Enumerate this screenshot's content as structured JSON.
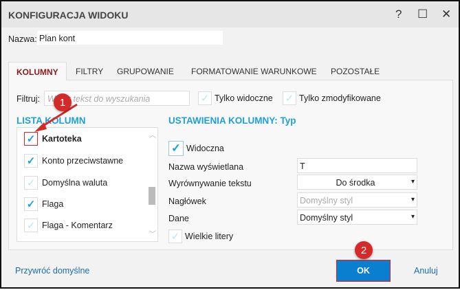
{
  "window": {
    "title": "KONFIGURACJA WIDOKU",
    "help": "?",
    "maximize": "☐",
    "close": "✕"
  },
  "name": {
    "label": "Nazwa:",
    "value": "Plan kont"
  },
  "tabs": [
    "KOLUMNY",
    "FILTRY",
    "GRUPOWANIE",
    "FORMATOWANIE WARUNKOWE",
    "POZOSTAŁE"
  ],
  "filter": {
    "label": "Filtruj:",
    "placeholder": "Wpisz tekst do wyszukania",
    "only_visible": "Tylko widoczne",
    "only_modified": "Tylko zmodyfikowane"
  },
  "column_list": {
    "heading": "LISTA KOLUMN",
    "items": [
      {
        "label": "Kartoteka",
        "checked": true
      },
      {
        "label": "Konto przeciwstawne",
        "checked": true
      },
      {
        "label": "Domyślna waluta",
        "checked": false
      },
      {
        "label": "Flaga",
        "checked": true
      },
      {
        "label": "Flaga - Komentarz",
        "checked": false
      }
    ]
  },
  "settings": {
    "heading": "USTAWIENIA KOLUMNY: Typ",
    "visible": "Widoczna",
    "display_name_label": "Nazwa wyświetlana",
    "display_name": "T",
    "align_label": "Wyrównywanie tekstu",
    "align": "Do środka",
    "header_label": "Nagłówek",
    "header": "Domyślny styl",
    "data_label": "Dane",
    "data": "Domyślny styl",
    "uppercase": "Wielkie litery"
  },
  "footer": {
    "restore": "Przywróć domyślne",
    "ok": "OK",
    "cancel": "Anuluj"
  },
  "annotations": [
    "1",
    "2"
  ]
}
